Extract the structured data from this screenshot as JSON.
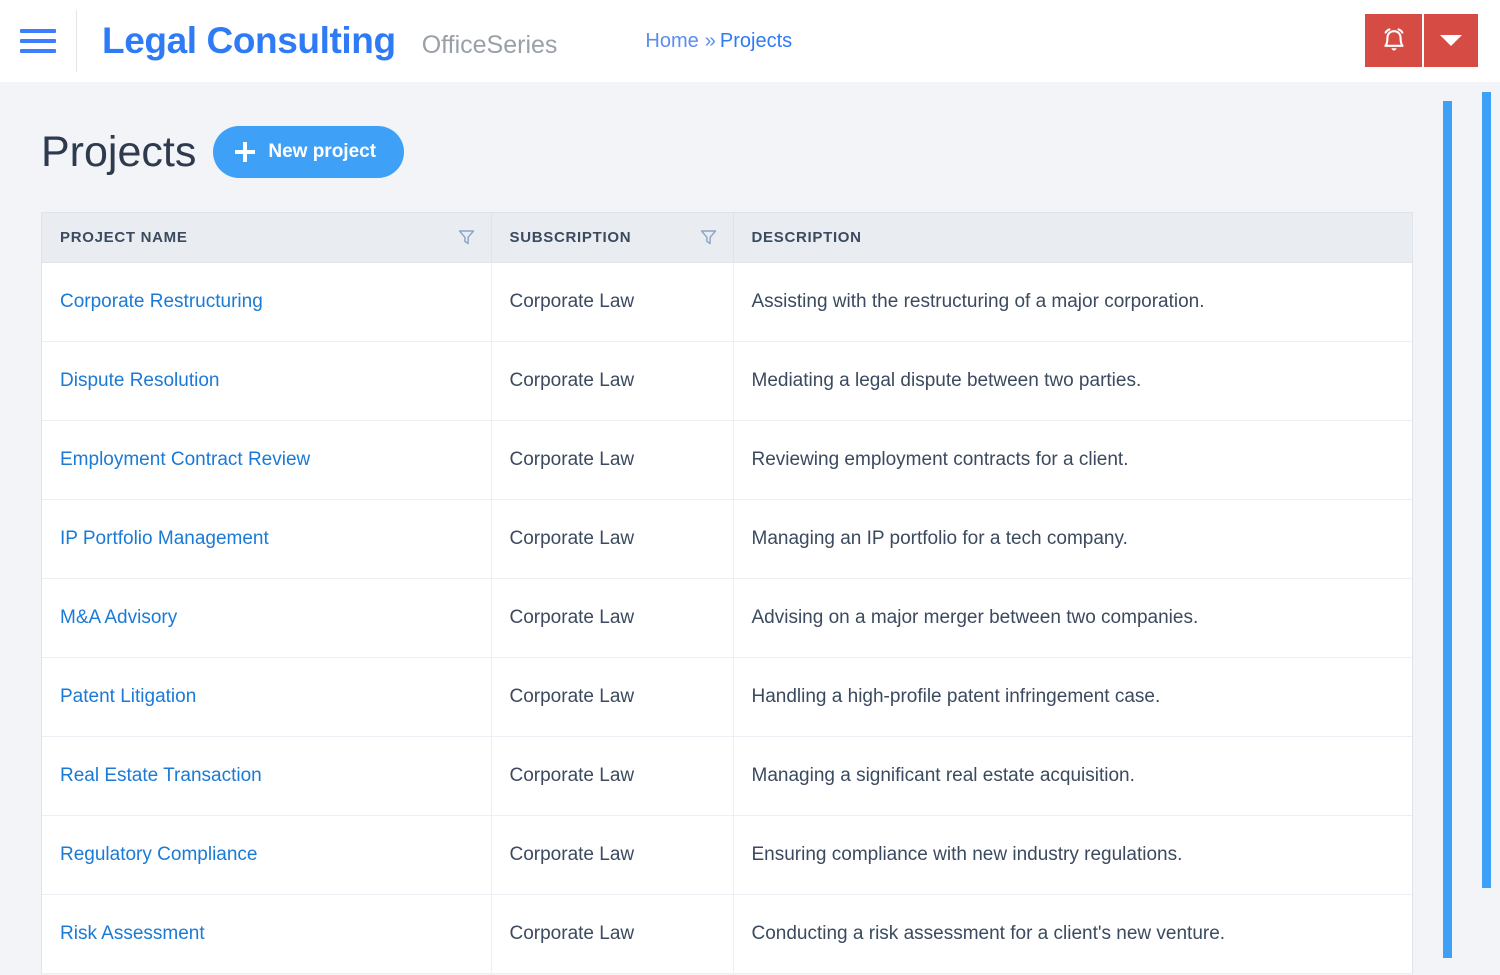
{
  "header": {
    "menu_icon": "hamburger-icon",
    "brand_title": "Legal Consulting",
    "brand_subtitle": "OfficeSeries",
    "breadcrumb": {
      "home_label": "Home",
      "separator": "»",
      "current_label": "Projects"
    },
    "actions": {
      "alarm_icon": "alarm-bell-icon",
      "caret_icon": "chevron-down-icon",
      "accent_color": "#d64b43"
    }
  },
  "main": {
    "page_title": "Projects",
    "new_project_label": "New project",
    "new_project_icon": "plus-icon",
    "accent_color": "#3fa0f7"
  },
  "table": {
    "columns": [
      {
        "label": "PROJECT NAME",
        "filter": true,
        "filter_icon": "filter-funnel-icon"
      },
      {
        "label": "SUBSCRIPTION",
        "filter": true,
        "filter_icon": "filter-funnel-icon"
      },
      {
        "label": "DESCRIPTION",
        "filter": false,
        "filter_icon": null
      }
    ],
    "rows": [
      {
        "name": "Corporate Restructuring",
        "subscription": "Corporate Law",
        "description": "Assisting with the restructuring of a major corporation."
      },
      {
        "name": "Dispute Resolution",
        "subscription": "Corporate Law",
        "description": "Mediating a legal dispute between two parties."
      },
      {
        "name": "Employment Contract Review",
        "subscription": "Corporate Law",
        "description": "Reviewing employment contracts for a client."
      },
      {
        "name": "IP Portfolio Management",
        "subscription": "Corporate Law",
        "description": "Managing an IP portfolio for a tech company."
      },
      {
        "name": "M&A Advisory",
        "subscription": "Corporate Law",
        "description": "Advising on a major merger between two companies."
      },
      {
        "name": "Patent Litigation",
        "subscription": "Corporate Law",
        "description": "Handling a high-profile patent infringement case."
      },
      {
        "name": "Real Estate Transaction",
        "subscription": "Corporate Law",
        "description": "Managing a significant real estate acquisition."
      },
      {
        "name": "Regulatory Compliance",
        "subscription": "Corporate Law",
        "description": "Ensuring compliance with new industry regulations."
      },
      {
        "name": "Risk Assessment",
        "subscription": "Corporate Law",
        "description": "Conducting a risk assessment for a client's new venture."
      }
    ]
  },
  "scrollbars": {
    "inner_color": "#3fa0f7",
    "outer_color": "#3fa0f7"
  }
}
